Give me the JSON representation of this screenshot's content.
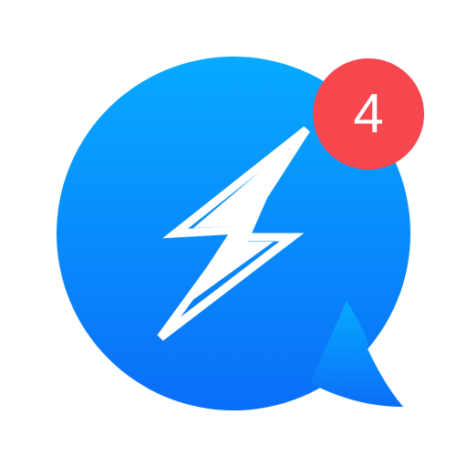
{
  "icon": {
    "name": "lightning-chat-bubble-icon",
    "bubble_gradient_top": "#07aaff",
    "bubble_gradient_bottom": "#0a6ef8",
    "bolt_color": "#ffffff"
  },
  "badge": {
    "count": "4",
    "color": "#f5474d",
    "text_color": "#ffffff"
  }
}
